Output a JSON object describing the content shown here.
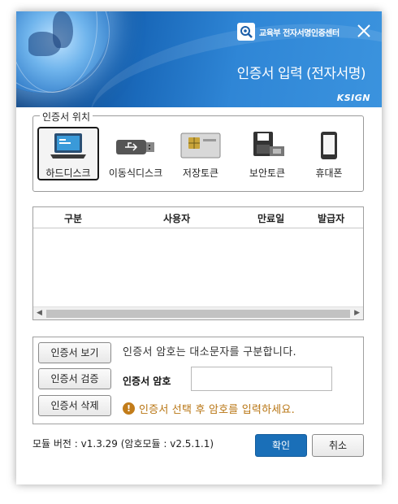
{
  "header": {
    "logo_text": "교육부 전자서명인증센터",
    "title": "인증서 입력 (전자서명)",
    "brand": "KSIGN",
    "close_icon": "close-icon"
  },
  "location": {
    "legend": "인증서 위치",
    "items": [
      {
        "label": "하드디스크",
        "icon": "laptop-icon",
        "selected": true
      },
      {
        "label": "이동식디스크",
        "icon": "usb-icon",
        "selected": false
      },
      {
        "label": "저장토큰",
        "icon": "token-icon",
        "selected": false
      },
      {
        "label": "보안토큰",
        "icon": "security-token-icon",
        "selected": false
      },
      {
        "label": "휴대폰",
        "icon": "phone-icon",
        "selected": false
      }
    ]
  },
  "cert_table": {
    "columns": [
      "구분",
      "사용자",
      "만료일",
      "발급자"
    ],
    "rows": []
  },
  "actions": {
    "view_label": "인증서 보기",
    "verify_label": "인증서 검증",
    "delete_label": "인증서 삭제"
  },
  "password": {
    "hint": "인증서 암호는 대소문자를 구분합니다.",
    "label": "인증서 암호",
    "value": "",
    "warning": "인증서 선택 후 암호를 입력하세요."
  },
  "footer": {
    "version": "모듈 버전 : v1.3.29 (암호모듈 : v2.5.1.1)",
    "ok_label": "확인",
    "cancel_label": "취소"
  },
  "colors": {
    "header_blue": "#2f86d6",
    "primary_button": "#1a6fb8",
    "warning": "#b87513"
  }
}
